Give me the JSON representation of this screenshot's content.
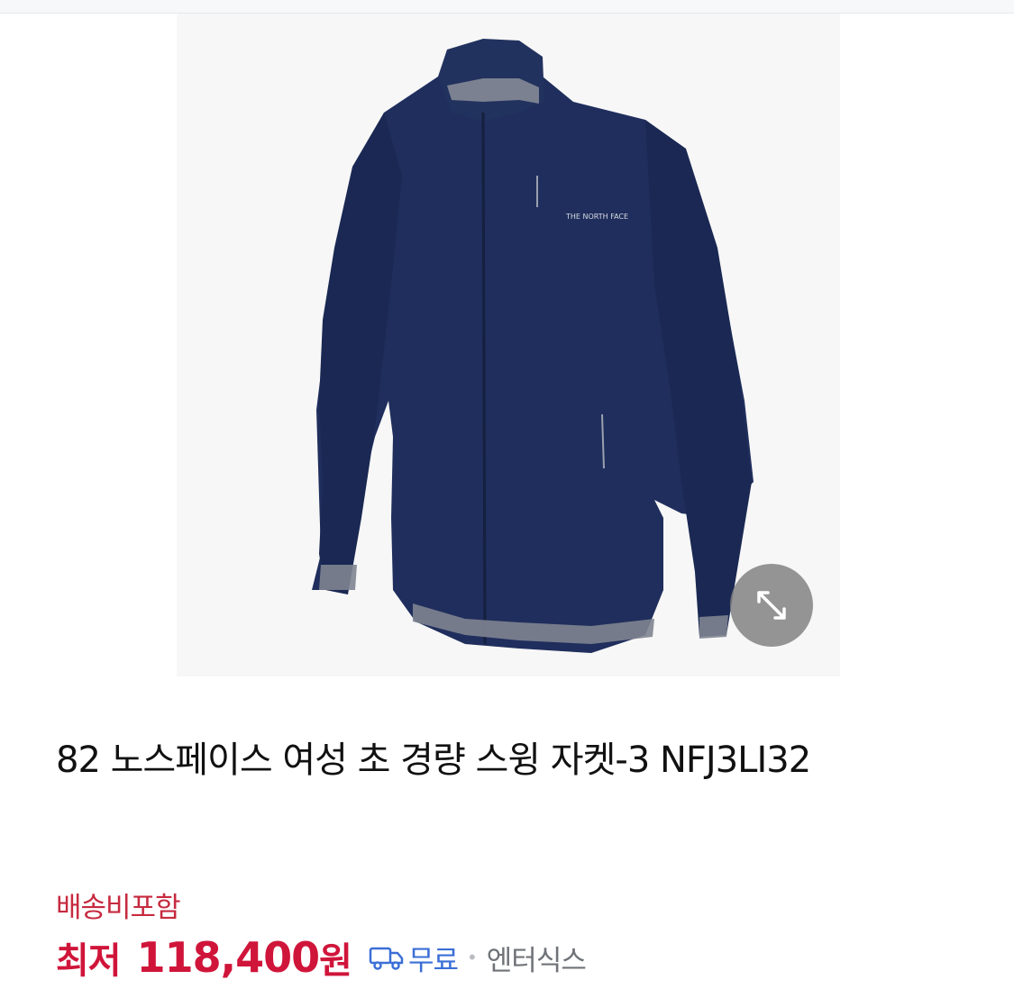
{
  "product": {
    "title": "82 노스페이스 여성 초 경량 스윙 자켓-3 NFJ3LI32",
    "image_alt": "navy jacket",
    "logo_text": "THE NORTH FACE"
  },
  "pricing": {
    "shipping_note": "배송비포함",
    "lowest_label": "최저",
    "price": "118,400",
    "currency_unit": "원"
  },
  "delivery": {
    "icon": "truck-icon",
    "label": "무료",
    "separator": "•",
    "seller": "엔터식스"
  },
  "zoom": {
    "icon": "expand-icon"
  },
  "colors": {
    "price_red": "#d0153a",
    "shipping_red": "#c62a3f",
    "delivery_blue": "#3b6fd6",
    "jacket_navy": "#1e2d5a"
  }
}
